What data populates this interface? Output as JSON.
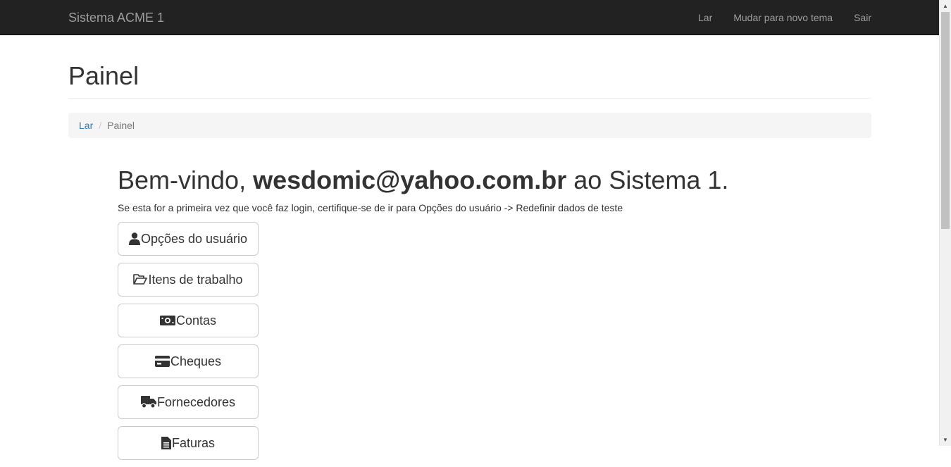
{
  "navbar": {
    "brand": "Sistema ACME 1",
    "links": [
      "Lar",
      "Mudar para novo tema",
      "Sair"
    ]
  },
  "page": {
    "title": "Painel"
  },
  "breadcrumb": {
    "home": "Lar",
    "separator": "/",
    "current": "Painel"
  },
  "welcome": {
    "prefix": "Bem-vindo, ",
    "email": "wesdomic@yahoo.com.br",
    "suffix": " ao Sistema 1.",
    "note": "Se esta for a primeira vez que você faz login, certifique-se de ir para Opções do usuário -> Redefinir dados de teste"
  },
  "menu_buttons": [
    {
      "label": "Opções do usuário",
      "icon": "user-icon"
    },
    {
      "label": "Itens de trabalho",
      "icon": "folder-open-icon"
    },
    {
      "label": "Contas",
      "icon": "money-bill-icon"
    },
    {
      "label": "Cheques",
      "icon": "credit-card-icon"
    },
    {
      "label": "Fornecedores",
      "icon": "truck-icon"
    },
    {
      "label": "Faturas",
      "icon": "file-icon"
    }
  ],
  "colors": {
    "navbar_bg": "#222222",
    "navbar_text": "#9d9d9d",
    "link": "#337ab7",
    "breadcrumb_bg": "#f5f5f5"
  }
}
